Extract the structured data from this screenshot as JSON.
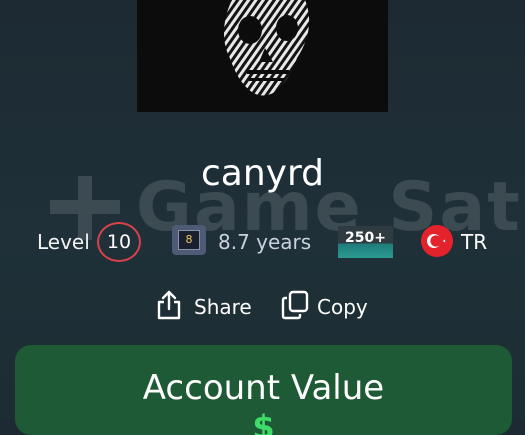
{
  "profile": {
    "username": "canyrd",
    "level_label": "Level",
    "level_value": "10",
    "years_badge_digit": "8",
    "years_text": "8.7 years",
    "count_badge": "250+",
    "country_code": "TR"
  },
  "actions": {
    "share_label": "Share",
    "copy_label": "Copy"
  },
  "value_card": {
    "title": "Account Value",
    "amount": "$"
  },
  "watermark": {
    "text": "Game Satis"
  },
  "colors": {
    "level_ring": "#d8414a",
    "value_card_bg": "#1e5a36",
    "amount_green": "#3ddc66",
    "flag_red": "#e4222c"
  },
  "icons": {
    "share": "share-icon",
    "copy": "copy-icon",
    "flag": "turkey-flag-icon",
    "years_badge": "years-of-service-icon"
  }
}
